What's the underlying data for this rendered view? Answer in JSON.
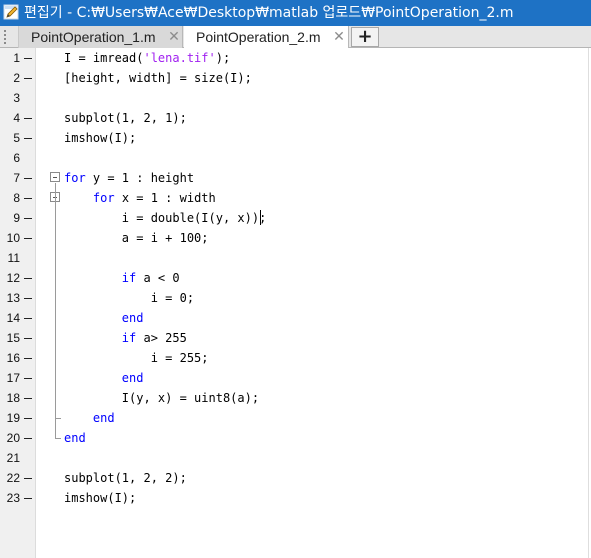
{
  "window": {
    "title": "편집기 - C:₩Users₩Ace₩Desktop₩matlab 업로드₩PointOperation_2.m",
    "icon": "editor-pencil-icon"
  },
  "tabs": [
    {
      "label": "PointOperation_1.m",
      "close": "✕",
      "active": false
    },
    {
      "label": "PointOperation_2.m",
      "close": "✕",
      "active": true
    }
  ],
  "add_tab_label": "+",
  "editor": {
    "lines": [
      {
        "n": "1",
        "exec": true,
        "segs": [
          {
            "t": "I = imread("
          },
          {
            "t": "'lena.tif'",
            "c": "str"
          },
          {
            "t": ");"
          }
        ]
      },
      {
        "n": "2",
        "exec": true,
        "segs": [
          {
            "t": "[height, width] = size(I);"
          }
        ]
      },
      {
        "n": "3",
        "exec": false,
        "segs": []
      },
      {
        "n": "4",
        "exec": true,
        "segs": [
          {
            "t": "subplot(1, 2, 1);"
          }
        ]
      },
      {
        "n": "5",
        "exec": true,
        "segs": [
          {
            "t": "imshow(I);"
          }
        ]
      },
      {
        "n": "6",
        "exec": false,
        "segs": []
      },
      {
        "n": "7",
        "exec": true,
        "segs": [
          {
            "t": "for",
            "c": "kw"
          },
          {
            "t": " y = 1 : height"
          }
        ]
      },
      {
        "n": "8",
        "exec": true,
        "segs": [
          {
            "t": "    "
          },
          {
            "t": "for",
            "c": "kw"
          },
          {
            "t": " x = 1 : width"
          }
        ]
      },
      {
        "n": "9",
        "exec": true,
        "segs": [
          {
            "t": "        i = double(I(y, x));"
          }
        ]
      },
      {
        "n": "10",
        "exec": true,
        "segs": [
          {
            "t": "        a = i + 100;"
          }
        ]
      },
      {
        "n": "11",
        "exec": false,
        "segs": []
      },
      {
        "n": "12",
        "exec": true,
        "segs": [
          {
            "t": "        "
          },
          {
            "t": "if",
            "c": "kw"
          },
          {
            "t": " a < 0"
          }
        ]
      },
      {
        "n": "13",
        "exec": true,
        "segs": [
          {
            "t": "            i = 0;"
          }
        ]
      },
      {
        "n": "14",
        "exec": true,
        "segs": [
          {
            "t": "        "
          },
          {
            "t": "end",
            "c": "kw"
          }
        ]
      },
      {
        "n": "15",
        "exec": true,
        "segs": [
          {
            "t": "        "
          },
          {
            "t": "if",
            "c": "kw"
          },
          {
            "t": " a> 255"
          }
        ]
      },
      {
        "n": "16",
        "exec": true,
        "segs": [
          {
            "t": "            i = 255;"
          }
        ]
      },
      {
        "n": "17",
        "exec": true,
        "segs": [
          {
            "t": "        "
          },
          {
            "t": "end",
            "c": "kw"
          }
        ]
      },
      {
        "n": "18",
        "exec": true,
        "segs": [
          {
            "t": "        I(y, x) = uint8(a);"
          }
        ]
      },
      {
        "n": "19",
        "exec": true,
        "segs": [
          {
            "t": "    "
          },
          {
            "t": "end",
            "c": "kw"
          }
        ]
      },
      {
        "n": "20",
        "exec": true,
        "segs": [
          {
            "t": "end",
            "c": "kw"
          }
        ]
      },
      {
        "n": "21",
        "exec": false,
        "segs": []
      },
      {
        "n": "22",
        "exec": true,
        "segs": [
          {
            "t": "subplot(1, 2, 2);"
          }
        ]
      },
      {
        "n": "23",
        "exec": true,
        "segs": [
          {
            "t": "imshow(I);"
          }
        ]
      }
    ]
  },
  "colors": {
    "titlebar": "#1e72c5",
    "keyword": "#0000ff",
    "string": "#a020f0"
  }
}
